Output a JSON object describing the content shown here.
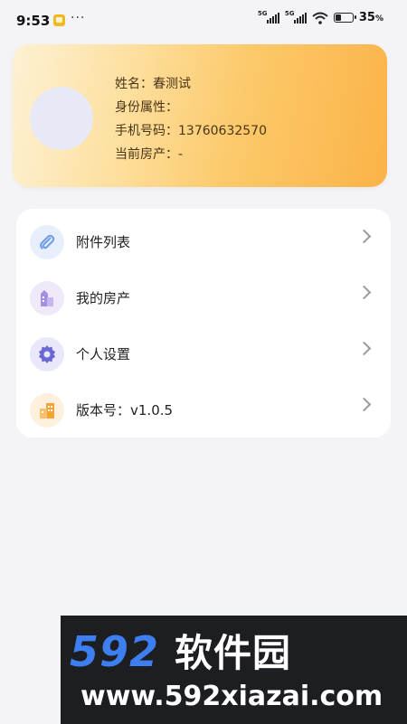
{
  "status_bar": {
    "time": "9:53",
    "signal_1_tag": "5G",
    "signal_2_tag": "5G",
    "battery_percent": "35",
    "battery_unit": "%",
    "battery_level": 0.35
  },
  "profile": {
    "name_line": "姓名：春测试",
    "identity_line": "身份属性：",
    "phone_line": "手机号码：13760632570",
    "property_line": "当前房产：-"
  },
  "menu": {
    "items": [
      {
        "label": "附件列表",
        "icon": "paperclip-icon",
        "icon_bg": "#e6effb",
        "icon_color": "#6e9be6"
      },
      {
        "label": "我的房产",
        "icon": "building-icon",
        "icon_bg": "#efe9f9",
        "icon_color": "#a58ee6"
      },
      {
        "label": "个人设置",
        "icon": "gear-icon",
        "icon_bg": "#e9e8fa",
        "icon_color": "#6b67d6"
      },
      {
        "label": "版本号：v1.0.5",
        "icon": "buildings-icon",
        "icon_bg": "#fdf0dc",
        "icon_color": "#f5a332"
      }
    ]
  },
  "watermark": {
    "number": "592",
    "brand": "软件园",
    "url": "www.592xiazai.com"
  }
}
